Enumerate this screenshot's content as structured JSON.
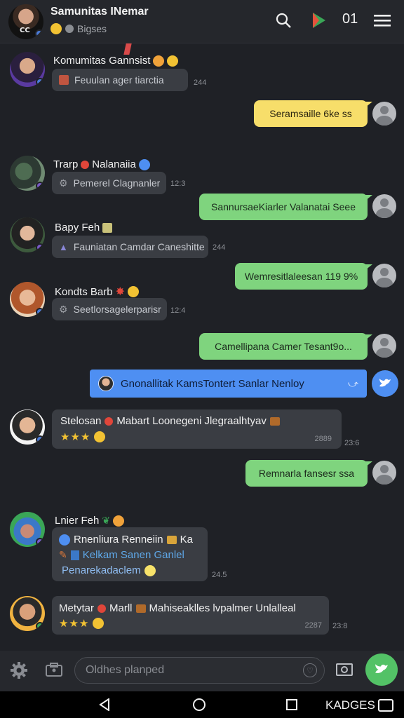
{
  "header": {
    "title": "Samunitas INemar",
    "subtitle": "Bigses",
    "count": "01",
    "avatar_text": "CC"
  },
  "messages": [
    {
      "name": "Komumitas Gannsist",
      "text": "Feuulan ager tiarctia",
      "time": "244"
    },
    {
      "out": "Seramsaille 6ke ss"
    },
    {
      "name": "Trarp",
      "name2": "Nalanaiia",
      "text": "Pemerel Clagnanler",
      "time": "12:3"
    },
    {
      "out": "SannursaeKiarler Valanatai Seee"
    },
    {
      "name": "Bapy Feh",
      "text": "Fauniatan Camdar Caneshitte",
      "time": "244"
    },
    {
      "out": "Wemresitlaleesan 119 9%"
    },
    {
      "name": "Kondts Barb",
      "text": "Seetlorsagelerparisr",
      "time": "12:4"
    },
    {
      "out": "Camellipana Camer Tesant9o..."
    },
    {
      "blue": "Gnonallitak KamsTontert Sanlar Nenloy"
    },
    {
      "name": "Stelosan",
      "name2": "Mabart Loonegeni Jlegraalhtyav",
      "stars": "★★★",
      "time_inner": "2889",
      "time": "23:6"
    },
    {
      "out": "Remnarla fansesr ssa"
    },
    {
      "name": "Lnier Feh",
      "line1": "Rnenliura Renneiin",
      "line1b": "Ka",
      "line2": "Kelkam Sanen Ganlel",
      "line3": "Penarekadaclem",
      "time": "24.5"
    },
    {
      "name": "Metytar",
      "name2": "Marll",
      "name3": "Mahiseaklles lvpalmer Unlalleal",
      "stars": "★★★",
      "time_inner": "2287",
      "time": "23:8"
    }
  ],
  "composer": {
    "placeholder": "Oldhes planped"
  },
  "navbar": {
    "label": "KADGES"
  },
  "colors": {
    "green": "#7fd47e",
    "yellow": "#f7de6a",
    "blue": "#4e8ff2",
    "send": "#53c266"
  }
}
